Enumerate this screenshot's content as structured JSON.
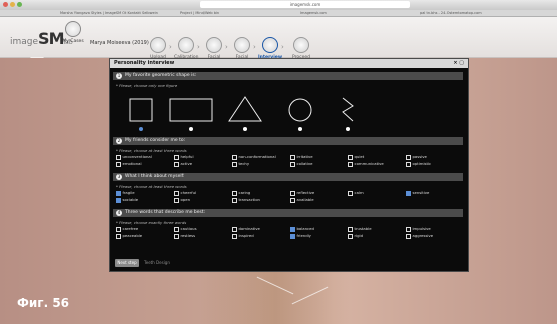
{
  "browser": {
    "url": "imagemsk.com",
    "tab1": "Marsha Yiangava Styles | ImageSM Ot Kontakt Selbwein",
    "tab2": "Project | Mind/Web bin",
    "tab3": "Imagemsk.com",
    "tab4": "pal tn.bhs - 24-Ostemtomatop.com"
  },
  "header": {
    "logo_pre": "image",
    "logo_main": "SM",
    "logo_suf": "lab",
    "my_cases": "My Cases",
    "user": "Marya Moiseeva (2019)",
    "steps": [
      {
        "label": "Upload"
      },
      {
        "label": "Calibration"
      },
      {
        "label": "Facial\nmap"
      },
      {
        "label": "Facial\ntype"
      },
      {
        "label": "Interview"
      },
      {
        "label": "Proceed\nto Design"
      }
    ]
  },
  "dialog": {
    "title": "Personality interview",
    "close": "× ▢",
    "q1": {
      "num": "1",
      "title": "My favorite geometric shape is:",
      "hint": "* Please, choose only one figure"
    },
    "q2": {
      "num": "2",
      "title": "My friends consider me to:",
      "hint": "* Please, choose at least three words",
      "words": [
        [
          "unconventional",
          "helpful",
          "non-conformational",
          "irritative",
          "quiet",
          "passive"
        ],
        [
          "emotional",
          "active",
          "techy",
          "collative",
          "communicative",
          "optimistic"
        ]
      ]
    },
    "q3": {
      "num": "3",
      "title": "What I think about myself:",
      "hint": "* Please, choose at least three words",
      "words": [
        [
          "fragile",
          "cheerful",
          "caring",
          "reflective",
          "calm",
          "sensitive"
        ],
        [
          "sociable",
          "open",
          "transaction",
          "available",
          "",
          ""
        ]
      ]
    },
    "q4": {
      "num": "4",
      "title": "Three words that describe me best:",
      "hint": "* Please, choose exactly three words",
      "words": [
        [
          "carefree",
          "cautious",
          "dominative",
          "balanced",
          "trustable",
          "impulsive"
        ],
        [
          "peaceable",
          "restless",
          "inspired",
          "friendly",
          "rigid",
          "aggressive"
        ]
      ]
    },
    "next_button": "Next step",
    "skip_link": "Teeth Design"
  },
  "figure_label": "Фиг. 56"
}
